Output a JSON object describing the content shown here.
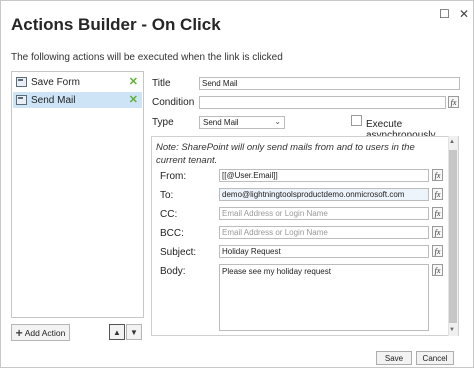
{
  "dialog": {
    "title": "Actions Builder - On Click",
    "subtitle": "The following actions will be executed when the link is clicked",
    "maximize_glyph": "☐",
    "close_glyph": "✕"
  },
  "actions_list": {
    "items": [
      {
        "label": "Save Form",
        "icon": "form-icon",
        "selected": false
      },
      {
        "label": "Send Mail",
        "icon": "mail-icon",
        "selected": true
      }
    ],
    "remove_glyph": "✕",
    "add_button": {
      "icon": "+",
      "label": "Add Action"
    },
    "move_up_glyph": "▲",
    "move_down_glyph": "▼"
  },
  "properties": {
    "title_label": "Title",
    "title_value": "Send Mail",
    "condition_label": "Condition",
    "condition_value": "",
    "type_label": "Type",
    "type_value": "Send Mail",
    "execute_async_label": "Execute asynchronously",
    "fx_glyph": "fx"
  },
  "mail": {
    "note": "Note: SharePoint will only send mails from and to users in the current tenant.",
    "from_label": "From:",
    "from_value": "[[@User.Email]]",
    "to_label": "To:",
    "to_value": "demo@lightningtoolsproductdemo.onmicrosoft.com",
    "cc_label": "CC:",
    "cc_placeholder": "Email Address or Login Name",
    "bcc_label": "BCC:",
    "bcc_placeholder": "Email Address or Login Name",
    "subject_label": "Subject:",
    "subject_value": "Holiday Request",
    "body_label": "Body:",
    "body_value": "Please see my holiday request"
  },
  "footer": {
    "save_label": "Save",
    "cancel_label": "Cancel"
  }
}
